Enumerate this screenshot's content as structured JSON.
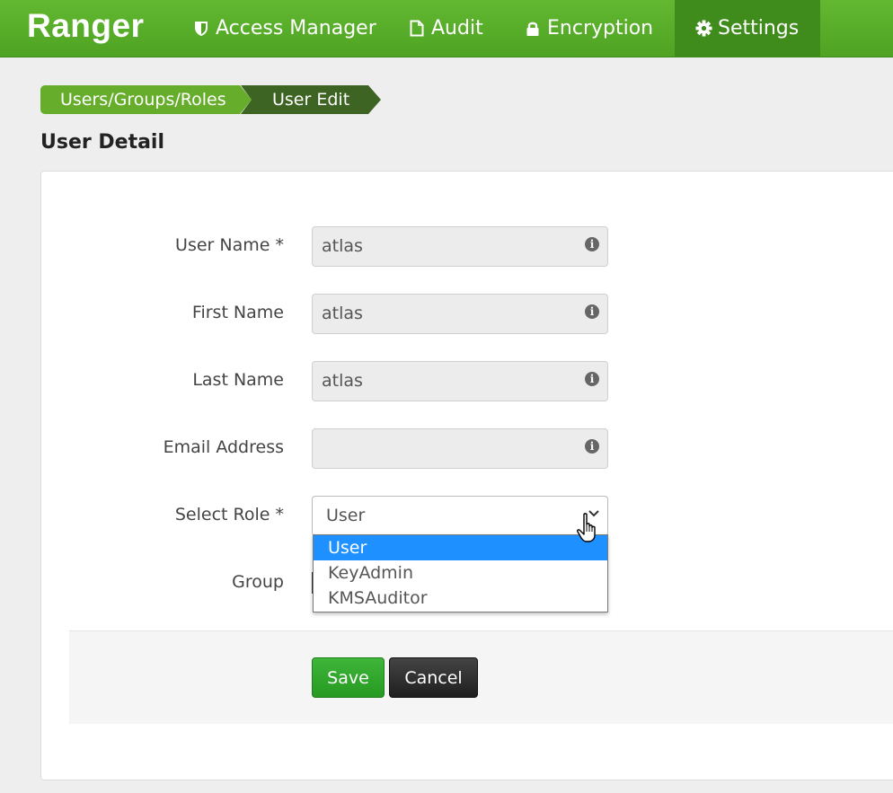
{
  "nav": {
    "brand": "Ranger",
    "items": [
      {
        "label": "Access Manager",
        "icon": "shield-icon",
        "active": false
      },
      {
        "label": "Audit",
        "icon": "file-icon",
        "active": false
      },
      {
        "label": "Encryption",
        "icon": "lock-icon",
        "active": false
      },
      {
        "label": "Settings",
        "icon": "gear-icon",
        "active": true
      }
    ]
  },
  "breadcrumb": [
    "Users/Groups/Roles",
    "User Edit"
  ],
  "page": {
    "title": "User Detail"
  },
  "form": {
    "user_name": {
      "label": "User Name *",
      "value": "atlas"
    },
    "first_name": {
      "label": "First Name",
      "value": "atlas"
    },
    "last_name": {
      "label": "Last Name",
      "value": "atlas"
    },
    "email": {
      "label": "Email Address",
      "value": ""
    },
    "role": {
      "label": "Select Role *",
      "value": "User",
      "options": [
        "User",
        "KeyAdmin",
        "KMSAuditor"
      ],
      "highlighted": "User"
    },
    "group": {
      "label": "Group"
    }
  },
  "actions": {
    "save": "Save",
    "cancel": "Cancel"
  },
  "colors": {
    "nav_green": "#4ea323",
    "active_nav": "#3f8c1c",
    "crumb_light": "#65ad2b",
    "crumb_dark": "#3e6424",
    "highlight": "#1e90ff",
    "save": "#269a21"
  }
}
